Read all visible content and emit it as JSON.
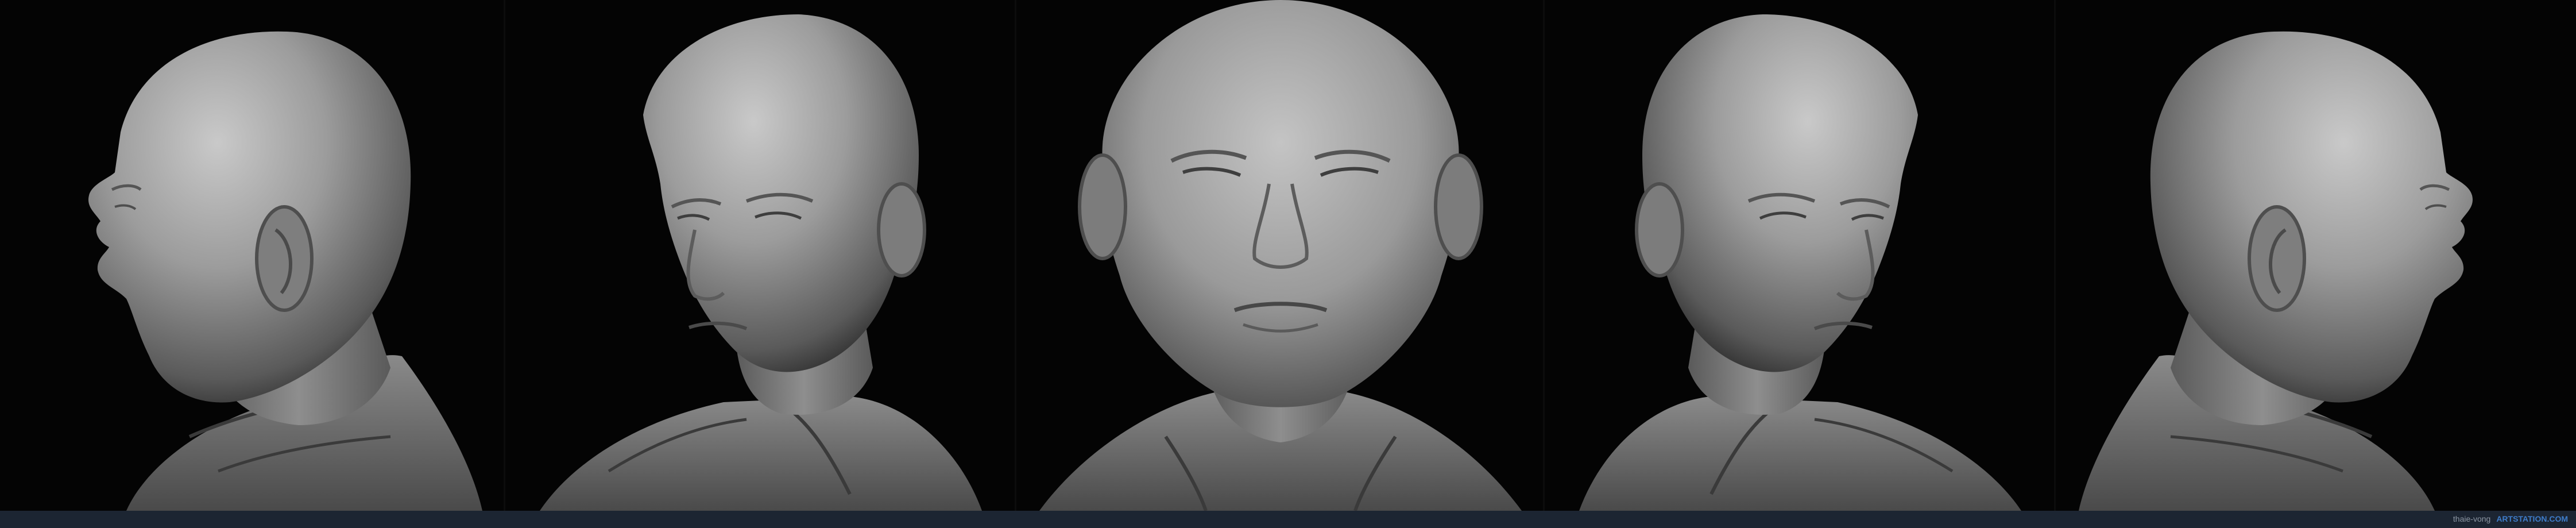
{
  "image": {
    "subject": "Five grayscale 3D sculpt renders of the same bald head and shoulders in a leather jacket",
    "views": [
      {
        "name": "left-profile"
      },
      {
        "name": "left-three-quarter"
      },
      {
        "name": "front"
      },
      {
        "name": "right-three-quarter"
      },
      {
        "name": "right-profile"
      }
    ]
  },
  "colors": {
    "background": "#000000",
    "sculpt_gray": "#9a9a9a",
    "bottom_bar": "#1c2532",
    "credit_link": "#3e7cc9"
  },
  "footer": {
    "author": "thaie-vong",
    "site": "ARTSTATION.COM"
  }
}
